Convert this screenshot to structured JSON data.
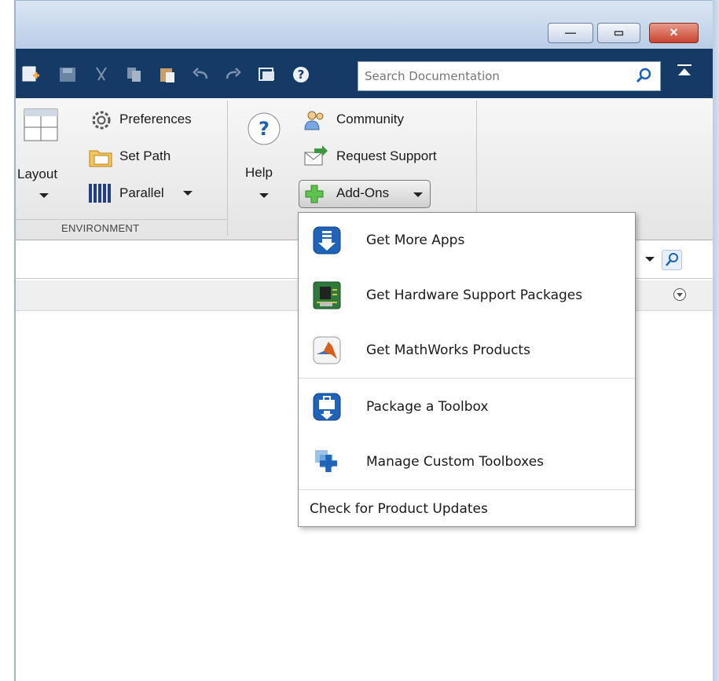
{
  "window": {
    "min_glyph": "—",
    "max_glyph": "▭",
    "close_glyph": "✕"
  },
  "search": {
    "placeholder": "Search Documentation"
  },
  "ribbon": {
    "layout_label": "Layout",
    "preferences_label": "Preferences",
    "set_path_label": "Set Path",
    "parallel_label": "Parallel",
    "environment_section": "ENVIRONMENT",
    "help_label": "Help",
    "community_label": "Community",
    "request_support_label": "Request Support",
    "addons_label": "Add-Ons"
  },
  "addons_menu": {
    "items": [
      {
        "label": "Get More Apps",
        "icon": "download-app-icon"
      },
      {
        "label": "Get Hardware Support Packages",
        "icon": "circuit-board-icon"
      },
      {
        "label": "Get MathWorks Products",
        "icon": "matlab-logo-icon"
      },
      {
        "label": "Package a Toolbox",
        "icon": "package-toolbox-icon"
      },
      {
        "label": "Manage Custom Toolboxes",
        "icon": "manage-toolboxes-icon"
      }
    ],
    "footer_label": "Check for Product Updates"
  },
  "colors": {
    "toolbar_bg": "#153a66",
    "accent_blue": "#2a6fc2",
    "close_red": "#c8442e"
  }
}
